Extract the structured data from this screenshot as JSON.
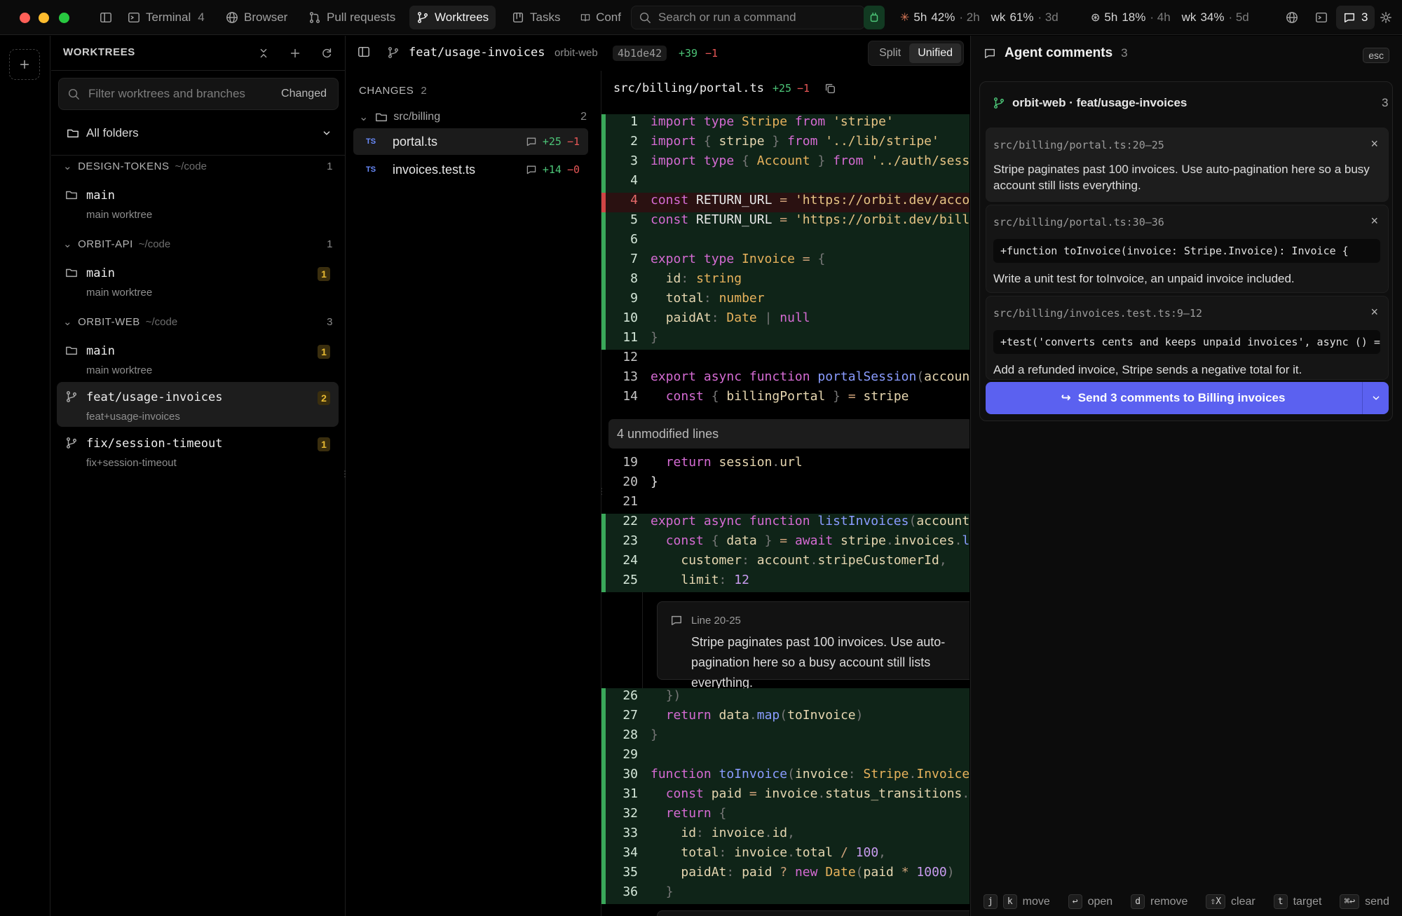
{
  "topbar": {
    "tabs": [
      {
        "label": "Terminal",
        "count": "4",
        "icon": "terminal-icon"
      },
      {
        "label": "Browser",
        "icon": "globe-icon"
      },
      {
        "label": "Pull requests",
        "icon": "pull-request-icon"
      },
      {
        "label": "Worktrees",
        "icon": "branch-icon",
        "active": true
      },
      {
        "label": "Tasks",
        "icon": "tasks-icon"
      },
      {
        "label": "Conf",
        "icon": "book-icon"
      }
    ],
    "search_placeholder": "Search or run a command",
    "usage": {
      "a": {
        "w1": "5h",
        "p1": "42%",
        "t1": "· 2h",
        "w2": "wk",
        "p2": "61%",
        "t2": "· 3d"
      },
      "b": {
        "w1": "5h",
        "p1": "18%",
        "t1": "· 4h",
        "w2": "wk",
        "p2": "34%",
        "t2": "· 5d"
      }
    },
    "comments_count": "3"
  },
  "sidebar": {
    "title": "WORKTREES",
    "filter_placeholder": "Filter worktrees and branches",
    "filter_mode": "Changed",
    "folders_label": "All folders",
    "groups": [
      {
        "name": "DESIGN-TOKENS",
        "path": "~/code",
        "count": "1"
      },
      {
        "name": "ORBIT-API",
        "path": "~/code",
        "count": "1"
      },
      {
        "name": "ORBIT-WEB",
        "path": "~/code",
        "count": "3"
      }
    ],
    "worktrees": [
      {
        "name": "main",
        "sub": "main worktree",
        "badge": ""
      },
      {
        "name": "main",
        "sub": "main worktree",
        "badge": "1"
      },
      {
        "name": "main",
        "sub": "main worktree",
        "badge": "1"
      },
      {
        "name": "feat/usage-invoices",
        "sub": "feat+usage-invoices",
        "badge": "2"
      },
      {
        "name": "fix/session-timeout",
        "sub": "fix+session-timeout",
        "badge": "1"
      }
    ]
  },
  "branchbar": {
    "branch": "feat/usage-invoices",
    "repo": "orbit-web",
    "commit": "4b1de42",
    "added": "+39",
    "removed": "−1",
    "view_split": "Split",
    "view_unified": "Unified"
  },
  "changes": {
    "title": "CHANGES",
    "count": "2",
    "folder": "src/billing",
    "folder_count": "2",
    "files": [
      {
        "ext": "TS",
        "name": "portal.ts",
        "added": "+25",
        "removed": "−1"
      },
      {
        "ext": "TS",
        "name": "invoices.test.ts",
        "added": "+14",
        "removed": "−0"
      }
    ]
  },
  "diff": {
    "file": "src/billing/portal.ts",
    "added": "+25",
    "removed": "−1",
    "unmodified": "4 unmodified lines",
    "inline_comment": {
      "range": "Line 20-25",
      "text": "Stripe paginates past 100 invoices. Use auto-pagination here so a busy account still lists everything."
    }
  },
  "panel": {
    "title": "Agent comments",
    "count": "3",
    "esc": "esc",
    "repo_label": "orbit-web · feat/usage-invoices",
    "repo_count": "3",
    "comments": [
      {
        "loc": "src/billing/portal.ts:20–25",
        "snippet": "",
        "text": "Stripe paginates past 100 invoices. Use auto-pagination here so a busy account still lists everything."
      },
      {
        "loc": "src/billing/portal.ts:30–36",
        "snippet": "+function toInvoice(invoice: Stripe.Invoice): Invoice {",
        "text": "Write a unit test for toInvoice, an unpaid invoice included."
      },
      {
        "loc": "src/billing/invoices.test.ts:9–12",
        "snippet": "+test('converts cents and keeps unpaid invoices', async () => {",
        "text": "Add a refunded invoice, Stripe sends a negative total for it."
      }
    ],
    "send_label": "Send 3 comments to Billing invoices",
    "hints": [
      {
        "keys": [
          "j",
          "k"
        ],
        "label": "move"
      },
      {
        "keys": [
          "↩"
        ],
        "label": "open"
      },
      {
        "keys": [
          "d"
        ],
        "label": "remove"
      },
      {
        "keys": [
          "⇧X"
        ],
        "label": "clear"
      },
      {
        "keys": [
          "t"
        ],
        "label": "target"
      },
      {
        "keys": [
          "⌘↩"
        ],
        "label": "send"
      }
    ]
  },
  "colors": {
    "accent": "#5b61f0",
    "added": "#4cc477",
    "removed": "#e55656",
    "badge": "#e7b931"
  }
}
